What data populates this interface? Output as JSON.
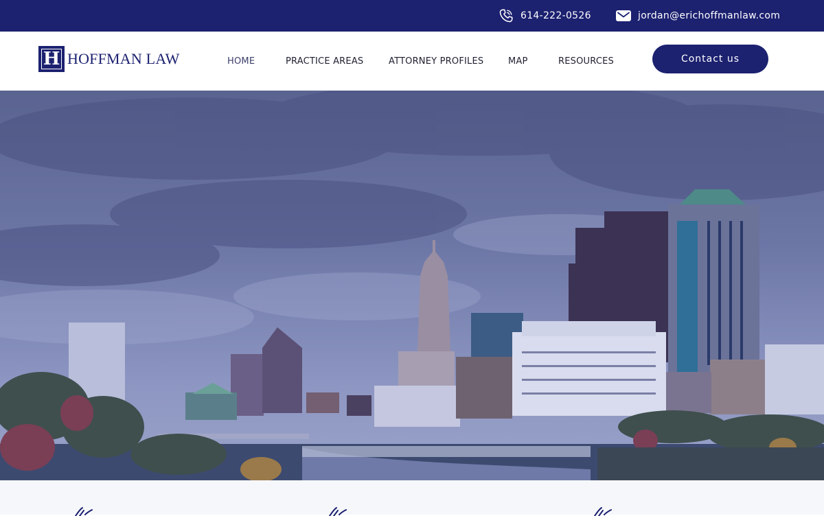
{
  "topbar": {
    "phone": "614-222-0526",
    "email": "jordan@erichoffmanlaw.com",
    "phone_icon": "phone-icon",
    "email_icon": "envelope-icon"
  },
  "header": {
    "logo_letter": "H",
    "logo_text": "HOFFMAN LAW",
    "nav": [
      {
        "label": "HOME",
        "active": true
      },
      {
        "label": "PRACTICE AREAS"
      },
      {
        "label": "ATTORNEY PROFILES"
      },
      {
        "label": "MAP"
      },
      {
        "label": "RESOURCES"
      }
    ],
    "cta_label": "Contact us"
  },
  "colors": {
    "brand": "#1c2170",
    "nav_text": "#1e2030"
  },
  "hero": {
    "image_icon": "city-skyline-image"
  },
  "features": {
    "icons": [
      "signature-icon",
      "signature-icon",
      "signature-icon"
    ]
  }
}
